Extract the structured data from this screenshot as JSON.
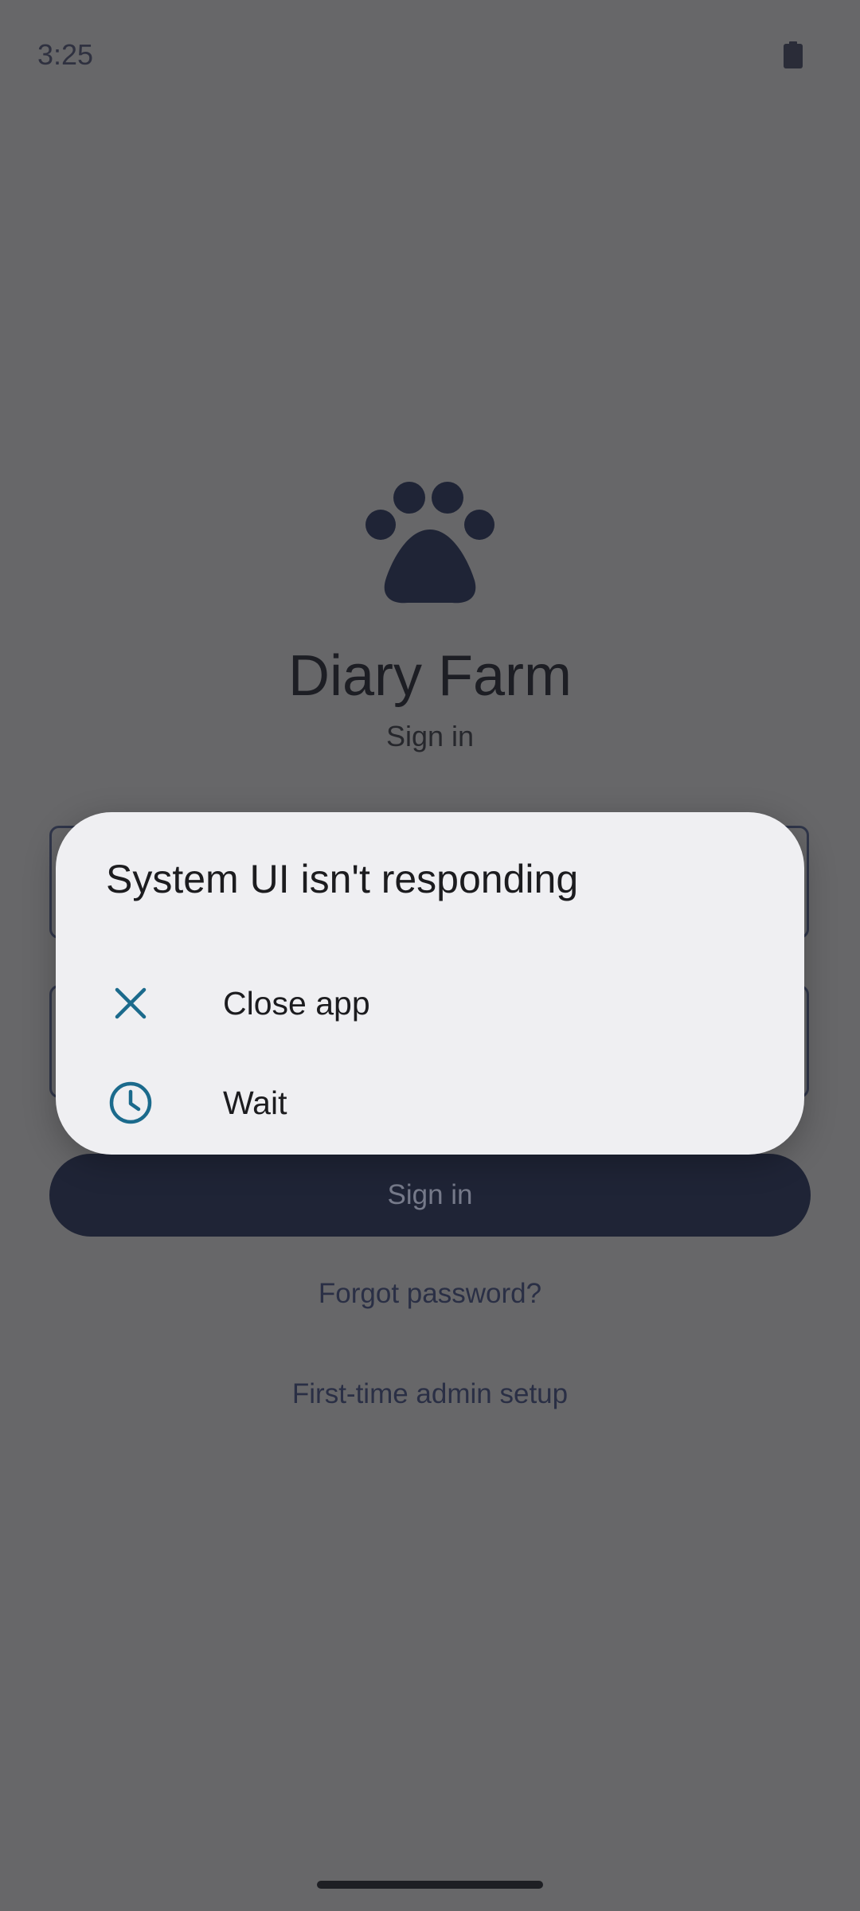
{
  "status_bar": {
    "time": "3:25",
    "battery_icon": "battery-full-icon"
  },
  "app": {
    "logo_icon": "paw-icon",
    "title": "Diary Farm",
    "subtitle": "Sign in",
    "sign_in_button": "Sign in",
    "forgot_password": "Forgot password?",
    "admin_setup": "First-time admin setup"
  },
  "dialog": {
    "title": "System UI isn't responding",
    "options": [
      {
        "label": "Close app",
        "icon": "close-icon"
      },
      {
        "label": "Wait",
        "icon": "clock-icon"
      }
    ]
  },
  "colors": {
    "scrim": "#676769",
    "dialog_bg": "#efeff2",
    "dialog_icon": "#1b6a8c",
    "primary": "#1f2436"
  }
}
